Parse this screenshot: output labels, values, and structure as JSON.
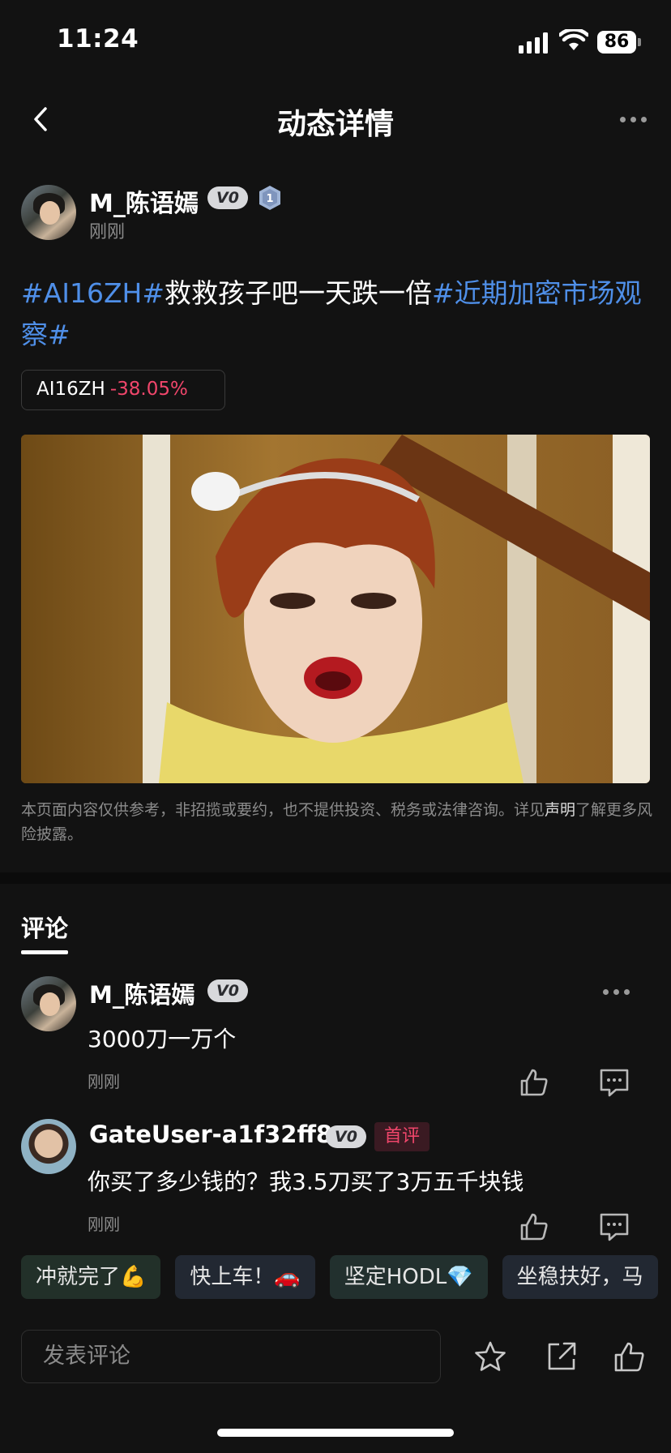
{
  "status_bar": {
    "time": "11:24",
    "battery": "86"
  },
  "nav": {
    "title": "动态详情"
  },
  "post": {
    "author": {
      "name": "M_陈语嫣",
      "vip_badge": "V0",
      "time": "刚刚"
    },
    "text_parts": [
      {
        "text": "#AI16ZH#",
        "kind": "tag"
      },
      {
        "text": "救救孩子吧一天跌一倍",
        "kind": "plain"
      },
      {
        "text": "#近期加密市场观察#",
        "kind": "tag"
      }
    ],
    "token_chip": {
      "symbol": "AI16ZH",
      "change": "-38.05%"
    },
    "disclaimer": {
      "text_before": "本页面内容仅供参考，非招揽或要约，也不提供投资、税务或法律咨询。详见",
      "link": "声明",
      "text_after": "了解更多风险披露。"
    }
  },
  "comments_section": {
    "tab_label": "评论",
    "comments": [
      {
        "name": "M_陈语嫣",
        "vip_badge": "V0",
        "text": "3000刀一万个",
        "time": "刚刚"
      },
      {
        "name": "GateUser-a1f32ff8",
        "vip_badge": "V0",
        "badge": "首评",
        "text": "你买了多少钱的？我3.5刀买了3万五千块钱",
        "time": "刚刚"
      }
    ]
  },
  "quick_replies": [
    "冲就完了💪",
    "快上车！🚗",
    "坚定HODL💎",
    "坐稳扶好，马"
  ],
  "bottom_bar": {
    "input_placeholder": "发表评论"
  },
  "colors": {
    "background": "#121212",
    "tag_blue": "#4f8fe8",
    "negative_red": "#f0466b"
  },
  "icons": [
    "back-arrow-icon",
    "more-dots-icon",
    "level-shield-icon",
    "thumbs-up-icon",
    "comment-bubble-icon",
    "star-icon",
    "share-icon"
  ]
}
